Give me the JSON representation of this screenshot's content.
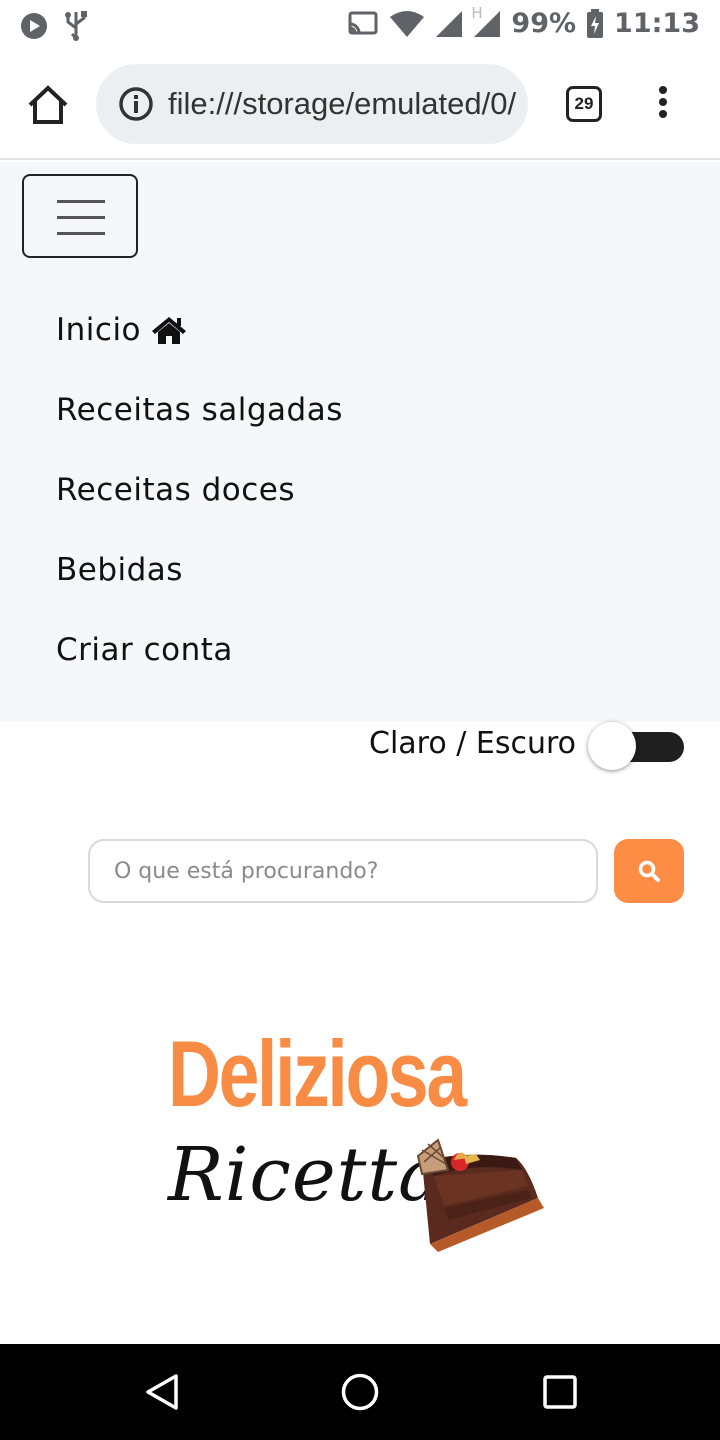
{
  "status": {
    "battery": "99%",
    "time": "11:13",
    "network_h": "H"
  },
  "browser": {
    "url": "file:///storage/emulated/0/",
    "tab_count": "29"
  },
  "nav": {
    "items": [
      {
        "label": "Inicio"
      },
      {
        "label": "Receitas salgadas"
      },
      {
        "label": "Receitas doces"
      },
      {
        "label": "Bebidas"
      },
      {
        "label": "Criar conta"
      }
    ]
  },
  "theme": {
    "label": "Claro / Escuro",
    "dark_mode": false
  },
  "search": {
    "placeholder": "O que está procurando?",
    "value": ""
  },
  "logo": {
    "line1": "Deliziosa",
    "line2": "Ricetta"
  },
  "colors": {
    "accent": "#fd8d44",
    "panel_bg": "#f6f7fa",
    "logo_orange": "#f98c45"
  }
}
